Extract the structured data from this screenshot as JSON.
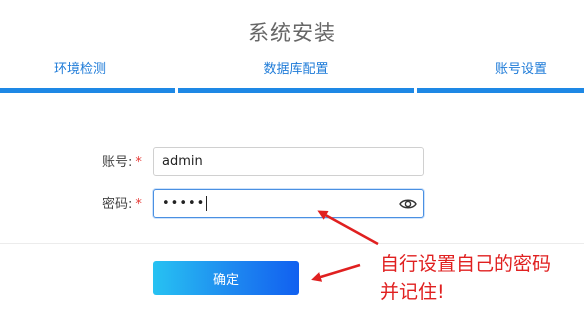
{
  "page": {
    "title": "系统安装"
  },
  "steps": [
    {
      "label": "环境检测"
    },
    {
      "label": "数据库配置"
    },
    {
      "label": "账号设置"
    }
  ],
  "form": {
    "account_label": "账号:",
    "account_value": "admin",
    "password_label": "密码:",
    "password_value": "•••••",
    "required_mark": "*"
  },
  "confirm_label": "确定",
  "annotation": {
    "line1": "自行设置自己的密码",
    "line2": "并记住!"
  },
  "colors": {
    "accent": "#1e88e5",
    "annotation": "#e02020",
    "required": "#e53935"
  }
}
